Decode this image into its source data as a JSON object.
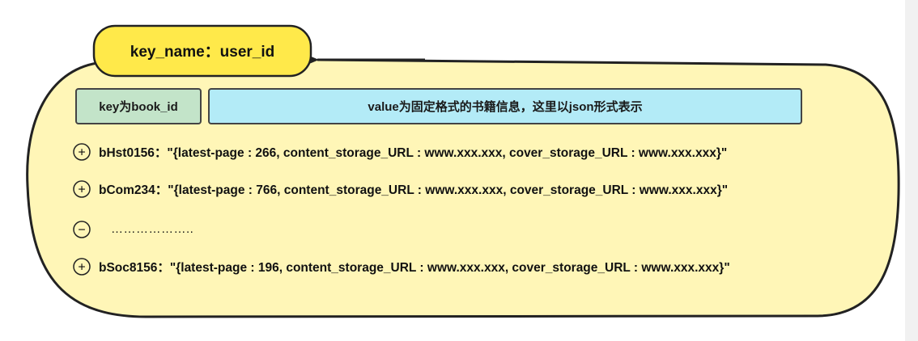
{
  "title": "key_name：user_id",
  "headers": {
    "key_label": "key为book_id",
    "value_label": "value为固定格式的书籍信息，这里以json形式表示"
  },
  "rows": [
    {
      "symbol": "+",
      "text": "bHst0156：\"{latest-page : 266, content_storage_URL : www.xxx.xxx, cover_storage_URL : www.xxx.xxx}\""
    },
    {
      "symbol": "+",
      "text": "bCom234：\"{latest-page : 766, content_storage_URL : www.xxx.xxx, cover_storage_URL : www.xxx.xxx}\""
    },
    {
      "symbol": "−",
      "text": "……………….."
    },
    {
      "symbol": "+",
      "text": "bSoc8156：\"{latest-page : 196, content_storage_URL : www.xxx.xxx, cover_storage_URL : www.xxx.xxx}\""
    }
  ],
  "colors": {
    "outer_fill": "#fff6b7",
    "title_fill": "#ffe94a",
    "key_box_fill": "#c3e4c9",
    "value_box_fill": "#b3ebf7",
    "stroke": "#222222"
  }
}
